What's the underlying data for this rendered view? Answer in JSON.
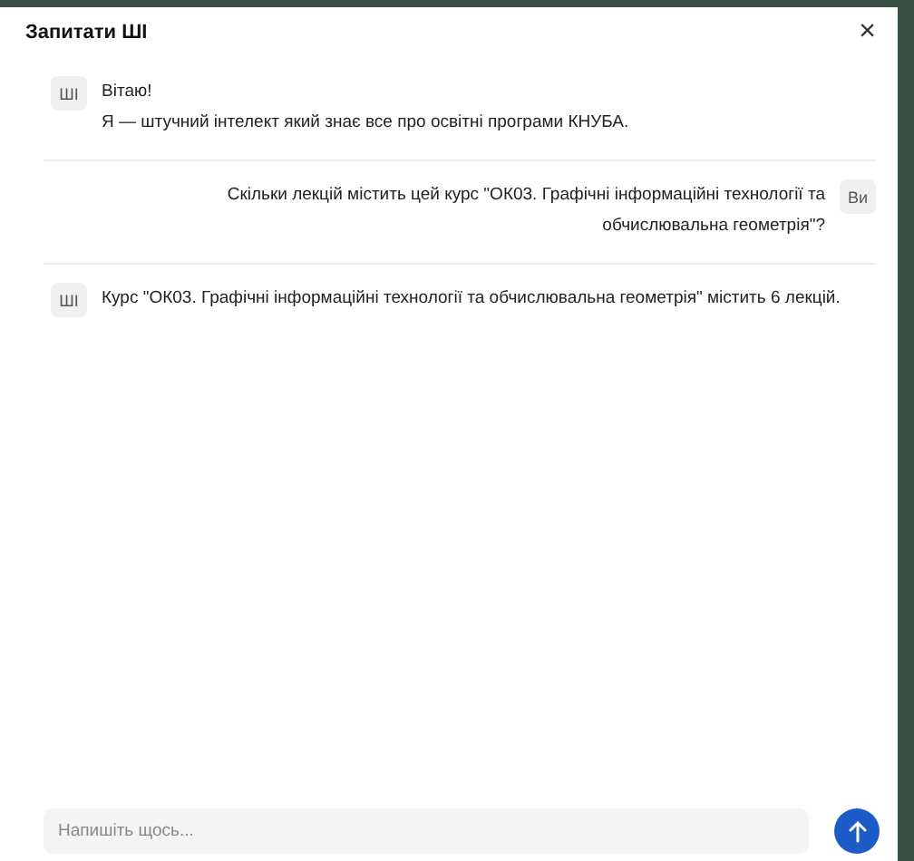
{
  "dialog": {
    "title": "Запитати ШІ",
    "close": "×"
  },
  "messages": [
    {
      "kind": "assistant",
      "avatar": "ШІ",
      "lines": [
        "Вітаю!",
        "Я — штучний інтелект який знає все про освітні програми КНУБА."
      ]
    },
    {
      "kind": "user",
      "avatar": "Ви",
      "lines": [
        "Скільки лекцій містить цей курс \"ОК03. Графічні інформаційні технології та обчислювальна геометрія\"?"
      ]
    },
    {
      "kind": "assistant",
      "avatar": "ШІ",
      "lines": [
        "Курс \"ОК03. Графічні інформаційні технології та обчислювальна геометрія\" містить 6 лекцій."
      ]
    }
  ],
  "composer": {
    "placeholder": "Напишіть щось..."
  }
}
